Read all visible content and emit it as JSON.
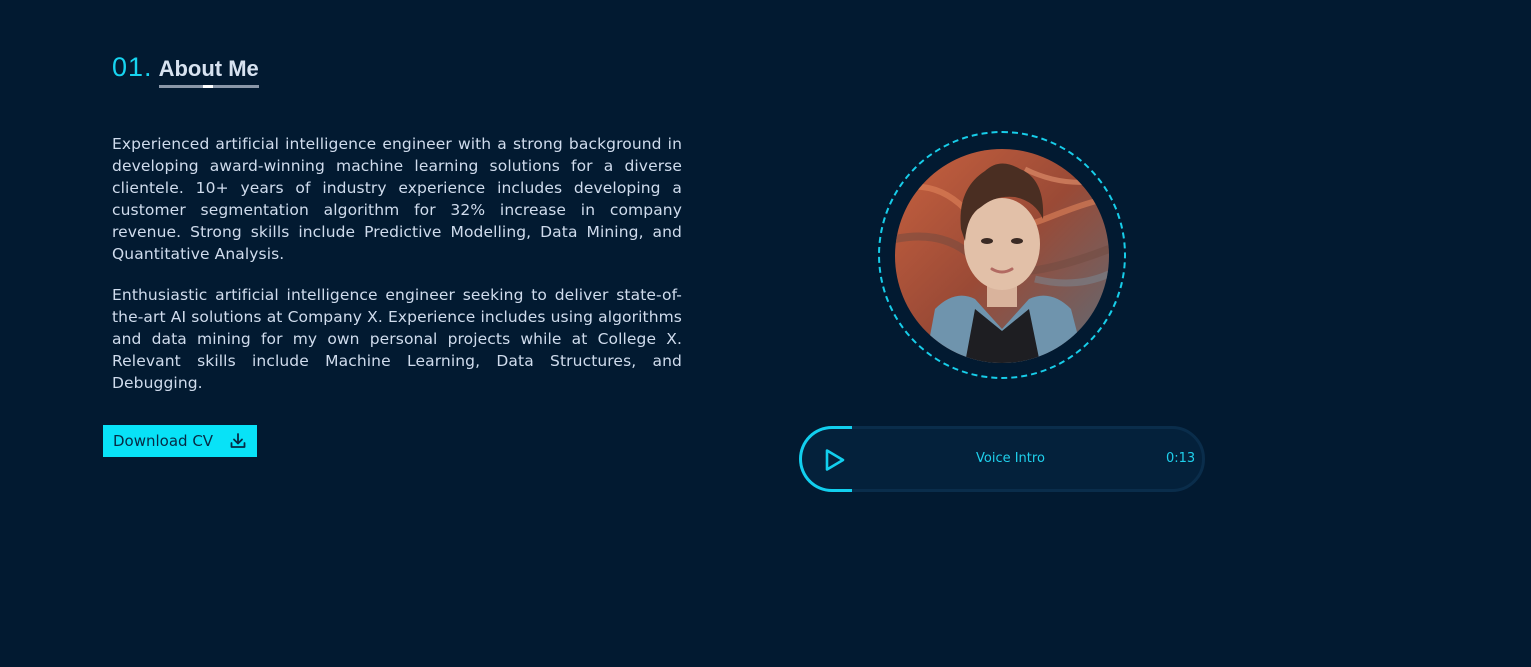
{
  "about": {
    "number": "01",
    "dot": ".",
    "title": "About Me",
    "paragraphs": [
      "Experienced artificial intelligence engineer with a strong background in developing award-winning machine learning solutions for a diverse clientele. 10+ years of industry experience includes developing a customer segmentation algorithm for 32% increase in company revenue. Strong skills include Predictive Modelling, Data Mining, and Quantitative Analysis.",
      "Enthusiastic artificial intelligence engineer seeking to deliver state-of-the-art AI solutions at Company X. Experience includes using algorithms and data mining for my own personal projects while at College X. Relevant skills include Machine Learning, Data Structures, and Debugging."
    ],
    "download_label": "Download CV",
    "download_icon": "download-icon"
  },
  "player": {
    "label": "Voice Intro",
    "time": "0:13",
    "play_icon": "play-icon"
  },
  "colors": {
    "background": "#021a31",
    "accent": "#08e2f7",
    "text": "#d0dced"
  }
}
